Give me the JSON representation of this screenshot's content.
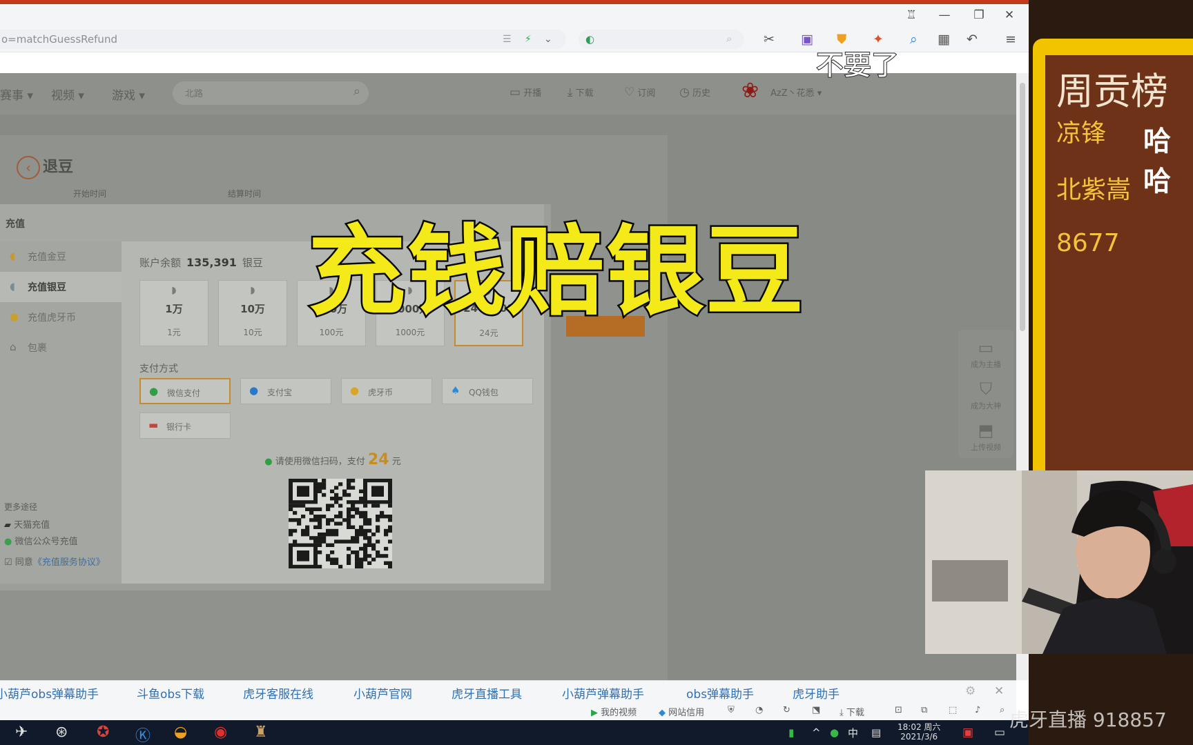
{
  "browser": {
    "url": "o=matchGuessRefund",
    "search_placeholder": "",
    "colors": {
      "top_strip": "#c23a17",
      "toolbar_bg": "#f4f5f7"
    }
  },
  "site": {
    "nav": [
      "赛事",
      "视频",
      "游戏"
    ],
    "search_placeholder": "北路",
    "tools": [
      "开播",
      "下载",
      "订阅",
      "历史"
    ],
    "user": "AzZ丶花悉"
  },
  "refund": {
    "back_label": "退豆",
    "columns": [
      "开始时间",
      "结算时间"
    ]
  },
  "modal": {
    "title": "充值",
    "sidebar": [
      {
        "icon": "gold-bean-icon",
        "label": "充值金豆"
      },
      {
        "icon": "silver-bean-icon",
        "label": "充值银豆"
      },
      {
        "icon": "huya-coin-icon",
        "label": "充值虎牙币"
      },
      {
        "icon": "bag-icon",
        "label": "包裹"
      }
    ],
    "more": {
      "title": "更多途径",
      "tmall": "天猫充值",
      "wechat": "微信公众号充值",
      "agree": "同意",
      "agreement": "《充值服务协议》"
    },
    "balance": {
      "label": "账户余额",
      "value": "135,391",
      "unit": "银豆"
    },
    "packages": [
      {
        "amount": "1万",
        "price": "1元"
      },
      {
        "amount": "10万",
        "price": "10元"
      },
      {
        "amount": "100万",
        "price": "100元"
      },
      {
        "amount": "1000万",
        "price": "1000元"
      },
      {
        "amount": "24 0,000",
        "price": "24元",
        "selected": true
      }
    ],
    "pay_label": "支付方式",
    "pay_methods": [
      {
        "icon": "wechat-pay-icon",
        "label": "微信支付",
        "selected": true
      },
      {
        "icon": "alipay-icon",
        "label": "支付宝"
      },
      {
        "icon": "huya-coin-icon",
        "label": "虎牙币"
      },
      {
        "icon": "qq-wallet-icon",
        "label": "QQ钱包"
      },
      {
        "icon": "bank-card-icon",
        "label": "银行卡"
      }
    ],
    "scan": {
      "prefix": "请使用微信扫码，支付",
      "amount": "24",
      "unit": "元"
    }
  },
  "rail": [
    "成为主播",
    "成为大神",
    "上传视频"
  ],
  "overlay": {
    "title": "充钱赔银豆",
    "subtitle": "不要了"
  },
  "bookmarks": [
    "小葫芦obs弹幕助手",
    "斗鱼obs下载",
    "虎牙客服在线",
    "小葫芦官网",
    "虎牙直播工具",
    "小葫芦弹幕助手",
    "obs弹幕助手",
    "虎牙助手"
  ],
  "status": {
    "my_video": "我的视频",
    "site_trust": "网站信用",
    "download": "下载"
  },
  "taskbar": {
    "ime": "中",
    "time": "18:02 周六",
    "date": "2021/3/6"
  },
  "stream": {
    "rank_title": "周贡榜",
    "ranks": [
      "凉锋",
      "北紫嵩",
      "8677"
    ],
    "chat": "哈哈",
    "watermark": "虎牙直播 918857"
  }
}
